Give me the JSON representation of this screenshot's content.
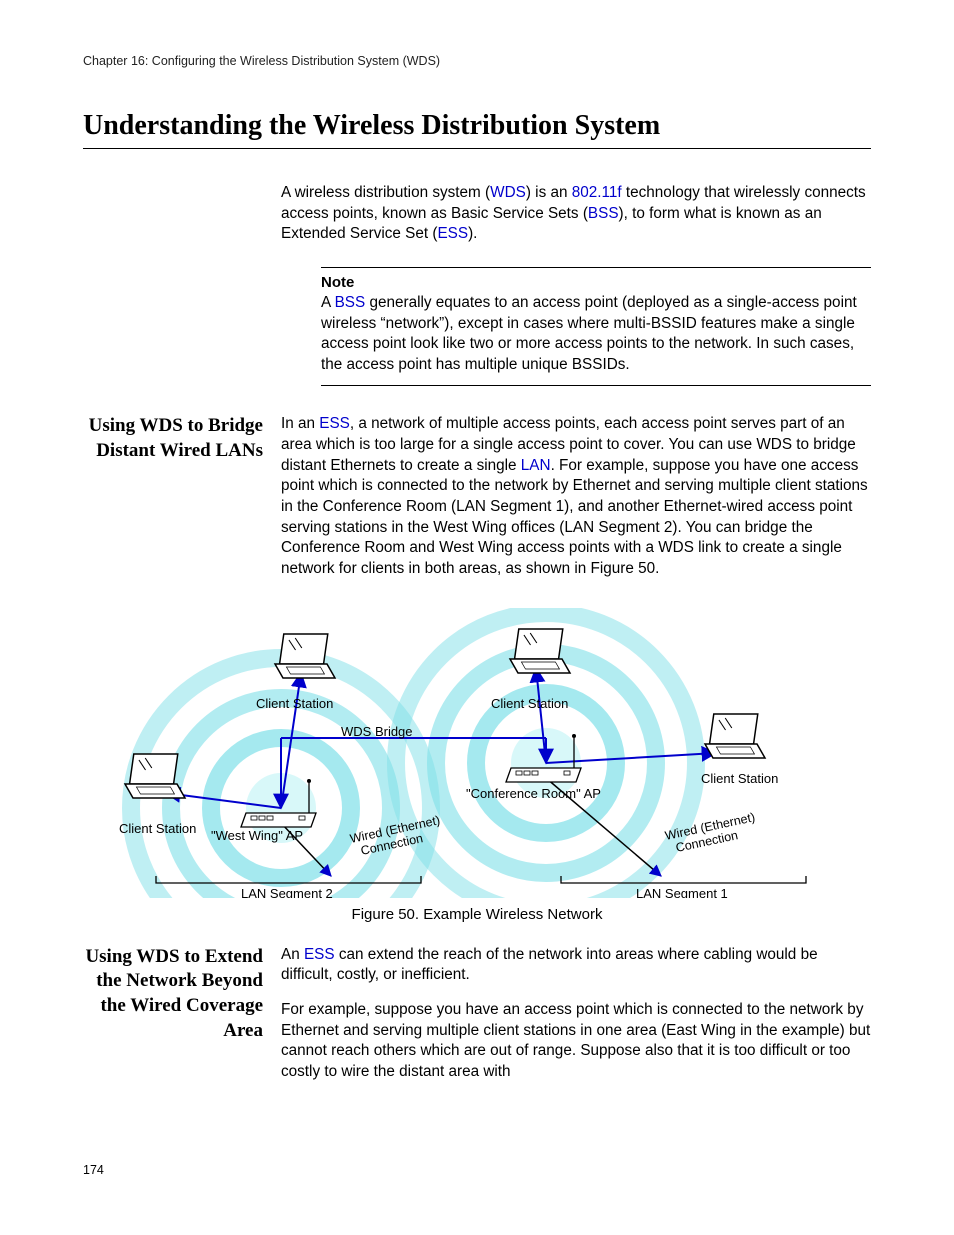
{
  "chapter_line": "Chapter 16: Configuring the Wireless Distribution System (WDS)",
  "heading": "Understanding the Wireless Distribution System",
  "intro": {
    "p1a": "A wireless distribution system (",
    "wds": "WDS",
    "p1b": ") is an ",
    "ieee": "802.11f",
    "p1c": " technology that wirelessly connects access points, known as Basic Service Sets (",
    "bss": "BSS",
    "p1d": "), to form what is known as an Extended Service Set (",
    "ess": "ESS",
    "p1e": ")."
  },
  "note": {
    "label": "Note",
    "t1": "A ",
    "bss": "BSS",
    "t2": " generally equates to an access point (deployed as a single-access point wireless “network”), except in cases where multi-BSSID features make a single access point look like two or more access points to the network. In such cases, the access point has multiple unique BSSIDs."
  },
  "section1": {
    "side": "Using WDS to Bridge Distant Wired LANs",
    "t1": "In an ",
    "ess": "ESS",
    "t2": ", a network of multiple access points, each access point serves part of an area which is too large for a single access point to cover. You can use WDS to bridge distant Ethernets to create a single ",
    "lan": "LAN",
    "t3": ". For example, suppose you have one access point which is connected to the network by Ethernet and serving multiple client stations in the Conference Room (LAN Segment 1), and another Ethernet-wired access point serving stations in the West Wing offices (LAN Segment 2). You can bridge the Conference Room and West Wing access points with a WDS link to create a single network for clients in both areas, as shown in Figure 50."
  },
  "figure": {
    "caption": "Figure 50. Example Wireless Network",
    "labels": {
      "client_station": "Client Station",
      "wds_bridge": "WDS Bridge",
      "west_wing_ap": "\"West Wing\" AP",
      "conference_ap": "\"Conference Room\" AP",
      "wired_conn_l1": "Wired (Ethernet)",
      "wired_conn_l2": "Connection",
      "lan_seg_1": "LAN Segment 1",
      "lan_seg_2": "LAN Segment 2"
    }
  },
  "section2": {
    "side": "Using WDS to Extend the Network Beyond the Wired Coverage Area",
    "p1a": "An ",
    "ess": "ESS",
    "p1b": " can extend the reach of the network into areas where cabling would be difficult, costly, or inefficient.",
    "p2": "For example, suppose you have an access point which is connected to the network by Ethernet and serving multiple client stations in one area (East Wing in the example) but cannot reach others which are out of range. Suppose also that it is too difficult or too costly to wire the distant area with"
  },
  "page_number": "174"
}
